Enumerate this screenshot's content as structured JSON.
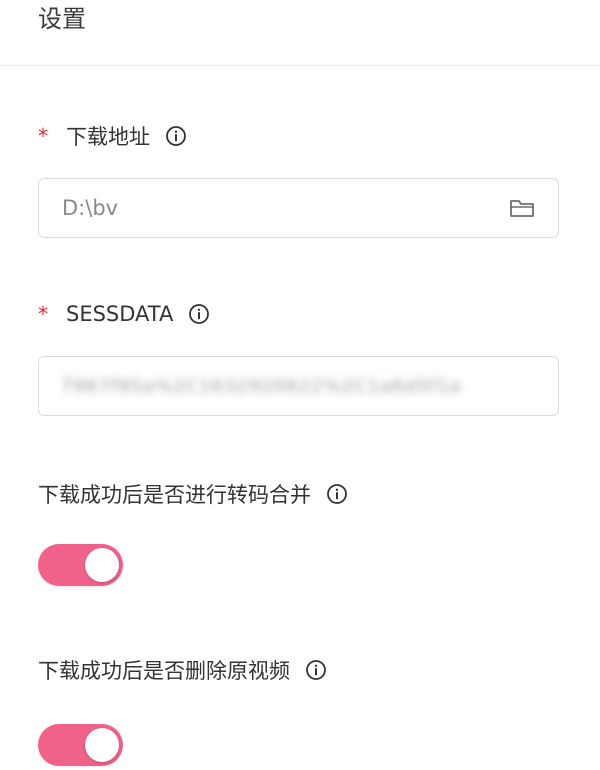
{
  "header": {
    "title": "设置"
  },
  "fields": {
    "download_path": {
      "required_mark": "*",
      "label": "下载地址",
      "value": "D:\\bv",
      "icon": "folder-icon"
    },
    "sessdata": {
      "required_mark": "*",
      "label": "SESSDATA",
      "value_obscured": "7967f95a%2C1632920622%2C1a6d5f1a",
      "value_is_blurred": true
    },
    "transcode_merge": {
      "label": "下载成功后是否进行转码合并",
      "enabled": true
    },
    "delete_original": {
      "label": "下载成功后是否删除原视频",
      "enabled": true
    }
  },
  "colors": {
    "accent": "#f0628a",
    "required": "#f5222d",
    "border": "#dcdcdc"
  }
}
